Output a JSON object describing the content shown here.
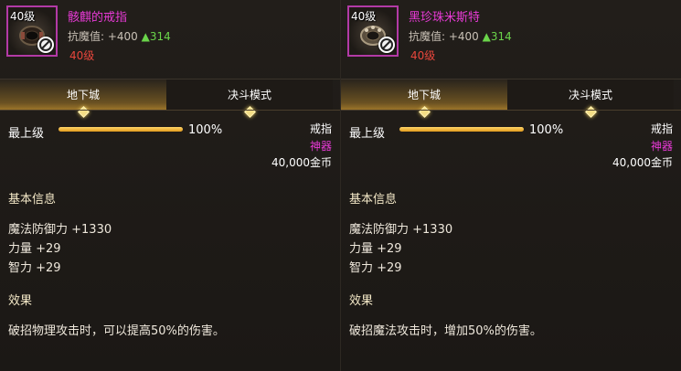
{
  "left": {
    "icon": {
      "level_text": "40级",
      "ring_color": "#3a2d24",
      "accent": "#b33aa6",
      "icon_name": "ring-icon",
      "restricted_icon": "no-entry-icon"
    },
    "name": "骸麒的戒指",
    "resist_label": "抗魔值: +400",
    "resist_up": "▲314",
    "level_req": "40级",
    "tabs": [
      "地下城",
      "决斗模式"
    ],
    "grade_label": "最上级",
    "grade_percent_value": 100,
    "grade_percent_text": "100%",
    "item_type": "戒指",
    "rarity": "神器",
    "price": "40,000金币",
    "basic_info_title": "基本信息",
    "stats": [
      "魔法防御力 +1330",
      "力量 +29",
      "智力 +29"
    ],
    "effect_title": "效果",
    "effect_text": "破招物理攻击时，可以提高50%的伤害。"
  },
  "right": {
    "icon": {
      "level_text": "40级",
      "ring_color": "#5a4e3e",
      "accent": "#b33aa6",
      "icon_name": "ring-icon",
      "restricted_icon": "no-entry-icon"
    },
    "name": "黑珍珠米斯特",
    "resist_label": "抗魔值: +400",
    "resist_up": "▲314",
    "level_req": "40级",
    "tabs": [
      "地下城",
      "决斗模式"
    ],
    "grade_label": "最上级",
    "grade_percent_value": 100,
    "grade_percent_text": "100%",
    "item_type": "戒指",
    "rarity": "神器",
    "price": "40,000金币",
    "basic_info_title": "基本信息",
    "stats": [
      "魔法防御力 +1330",
      "力量 +29",
      "智力 +29"
    ],
    "effect_title": "效果",
    "effect_text": "破招魔法攻击时，增加50%的伤害。"
  },
  "colors": {
    "name": "#e83ad6",
    "level_req": "#e8463c",
    "resist_up": "#6ad44a",
    "bar_fill": "#e19a1c"
  }
}
